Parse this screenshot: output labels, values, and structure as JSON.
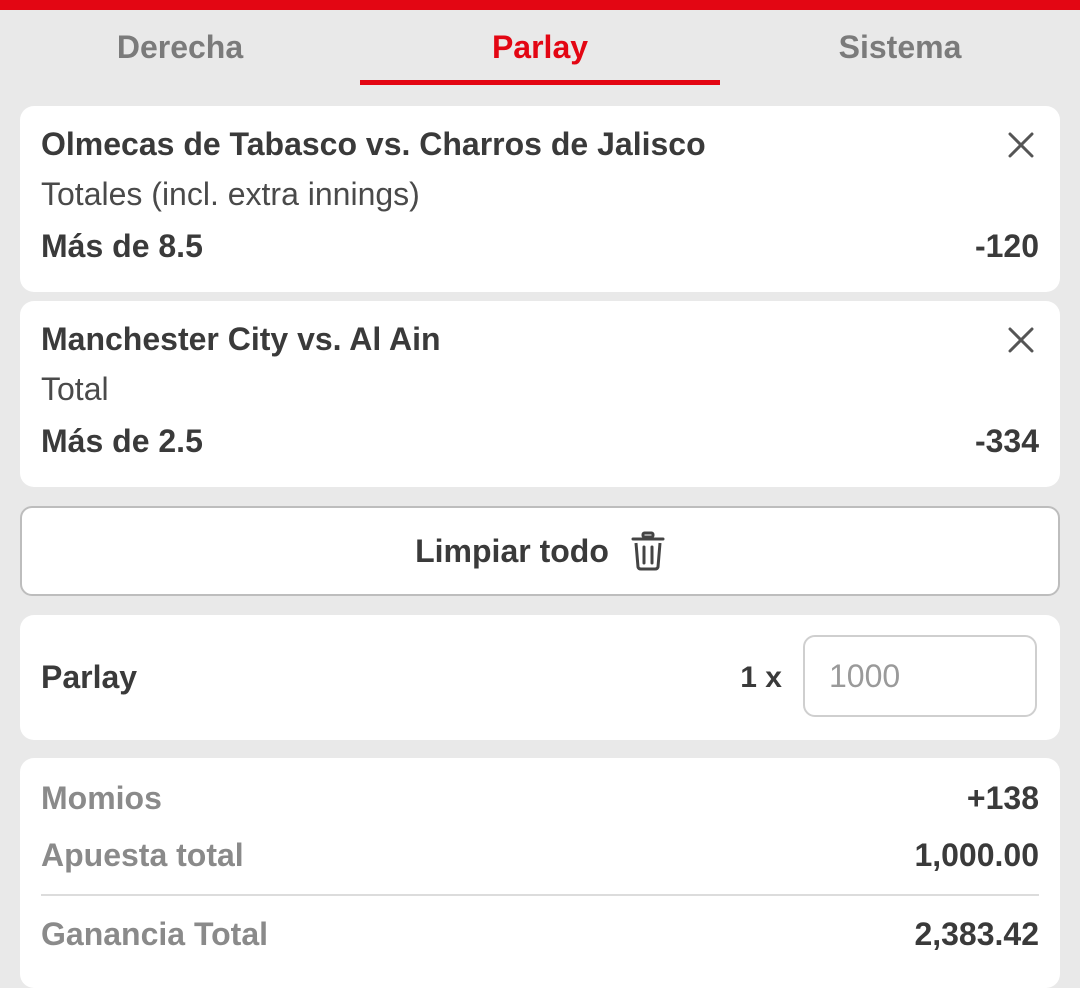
{
  "tabs": [
    {
      "label": "Derecha"
    },
    {
      "label": "Parlay"
    },
    {
      "label": "Sistema"
    }
  ],
  "active_tab": "Parlay",
  "bets": [
    {
      "event": "Olmecas de Tabasco vs. Charros de Jalisco",
      "market": "Totales (incl. extra innings)",
      "selection": "Más de 8.5",
      "odds": "-120"
    },
    {
      "event": "Manchester City vs. Al Ain",
      "market": "Total",
      "selection": "Más de 2.5",
      "odds": "-334"
    }
  ],
  "clear_all": {
    "label": "Limpiar todo",
    "icon": "trash-icon"
  },
  "parlay": {
    "label": "Parlay",
    "multiplier": "1 x",
    "stake_placeholder": "1000"
  },
  "summary": {
    "odds_label": "Momios",
    "odds_value": "+138",
    "stake_label": "Apuesta total",
    "stake_value": "1,000.00",
    "win_label": "Ganancia Total",
    "win_value": "2,383.42"
  },
  "colors": {
    "accent": "#e30613",
    "background": "#e9e9e9",
    "card": "#ffffff"
  }
}
